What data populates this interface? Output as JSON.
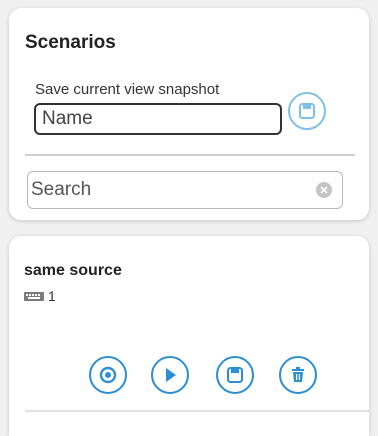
{
  "panel": {
    "title": "Scenarios",
    "save_hint": "Save current view snapshot",
    "name_placeholder": "Name",
    "search_placeholder": "Search",
    "save_icon": "save-icon",
    "clear_icon": "clear-icon"
  },
  "scenario": {
    "title": "same source",
    "count": "1",
    "meta_icon": "keyboard-icon",
    "actions": [
      "view",
      "play",
      "save",
      "delete"
    ]
  },
  "colors": {
    "accent": "#2d8fd1",
    "accent_light": "#7fc0e8"
  }
}
